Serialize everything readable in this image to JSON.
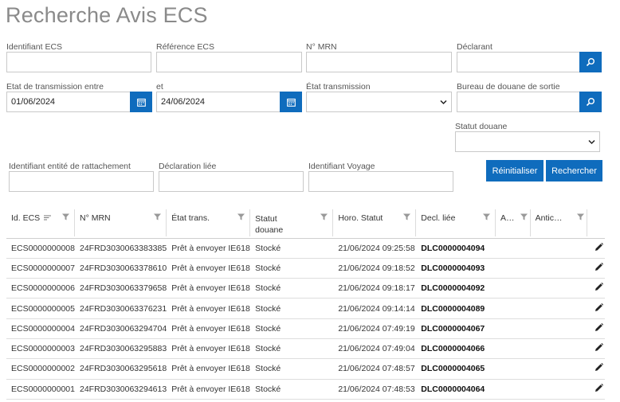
{
  "page": {
    "title": "Recherche Avis ECS"
  },
  "filters": {
    "identifiant_ecs": {
      "label": "Identifiant ECS",
      "value": ""
    },
    "reference_ecs": {
      "label": "Référence ECS",
      "value": ""
    },
    "mrn": {
      "label": "N° MRN",
      "value": ""
    },
    "declarant": {
      "label": "Déclarant",
      "value": ""
    },
    "date_from": {
      "label": "Etat de transmission entre",
      "value": "01/06/2024"
    },
    "date_to": {
      "label": "et",
      "value": "24/06/2024"
    },
    "etat_transmission": {
      "label": "État transmission",
      "value": ""
    },
    "bureau_sortie": {
      "label": "Bureau de douane de sortie",
      "value": ""
    },
    "statut_douane": {
      "label": "Statut douane",
      "value": ""
    },
    "entite_rattachement": {
      "label": "Identifiant entité de rattachement",
      "value": ""
    },
    "declaration_liee": {
      "label": "Déclaration liée",
      "value": ""
    },
    "identifiant_voyage": {
      "label": "Identifiant Voyage",
      "value": ""
    }
  },
  "actions": {
    "reset_label": "Réinitialiser",
    "search_label": "Rechercher"
  },
  "table": {
    "columns": [
      "Id. ECS",
      "N° MRN",
      "État trans.",
      "Statut douane",
      "Horo. Statut",
      "Decl. liée",
      "A…",
      "Antic…"
    ],
    "rows": [
      [
        "ECS0000000008",
        "24FRD3030063383385",
        "Prêt à envoyer IE618",
        "Stocké",
        "21/06/2024 09:25:58",
        "DLC0000004094"
      ],
      [
        "ECS0000000007",
        "24FRD3030063378610",
        "Prêt à envoyer IE618",
        "Stocké",
        "21/06/2024 09:18:52",
        "DLC0000004093"
      ],
      [
        "ECS0000000006",
        "24FRD3030063379658",
        "Prêt à envoyer IE618",
        "Stocké",
        "21/06/2024 09:18:17",
        "DLC0000004092"
      ],
      [
        "ECS0000000005",
        "24FRD3030063376231",
        "Prêt à envoyer IE618",
        "Stocké",
        "21/06/2024 09:14:14",
        "DLC0000004089"
      ],
      [
        "ECS0000000004",
        "24FRD3030063294704",
        "Prêt à envoyer IE618",
        "Stocké",
        "21/06/2024 07:49:19",
        "DLC0000004067"
      ],
      [
        "ECS0000000003",
        "24FRD3030063295883",
        "Prêt à envoyer IE618",
        "Stocké",
        "21/06/2024 07:49:04",
        "DLC0000004066"
      ],
      [
        "ECS0000000002",
        "24FRD3030063295618",
        "Prêt à envoyer IE618",
        "Stocké",
        "21/06/2024 07:48:57",
        "DLC0000004065"
      ],
      [
        "ECS0000000001",
        "24FRD3030063294613",
        "Prêt à envoyer IE618",
        "Stocké",
        "21/06/2024 07:48:53",
        "DLC0000004064"
      ]
    ]
  },
  "colors": {
    "accent": "#0f6cbd"
  }
}
